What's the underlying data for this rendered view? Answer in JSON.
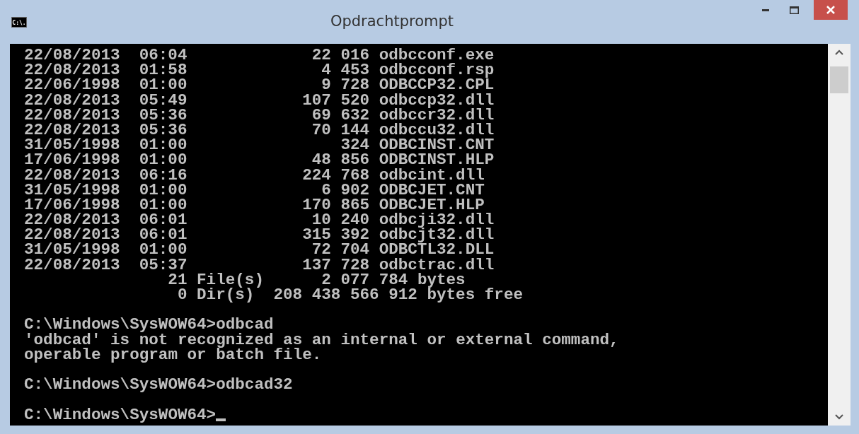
{
  "window": {
    "title": "Opdrachtprompt",
    "icon_text": "C:\\."
  },
  "console": {
    "listing": [
      {
        "date": "22/08/2013",
        "time": "06:04",
        "size": "22 016",
        "name": "odbcconf.exe"
      },
      {
        "date": "22/08/2013",
        "time": "01:58",
        "size": "4 453",
        "name": "odbcconf.rsp"
      },
      {
        "date": "22/06/1998",
        "time": "01:00",
        "size": "9 728",
        "name": "ODBCCP32.CPL"
      },
      {
        "date": "22/08/2013",
        "time": "05:49",
        "size": "107 520",
        "name": "odbccp32.dll"
      },
      {
        "date": "22/08/2013",
        "time": "05:36",
        "size": "69 632",
        "name": "odbccr32.dll"
      },
      {
        "date": "22/08/2013",
        "time": "05:36",
        "size": "70 144",
        "name": "odbccu32.dll"
      },
      {
        "date": "31/05/1998",
        "time": "01:00",
        "size": "324",
        "name": "ODBCINST.CNT"
      },
      {
        "date": "17/06/1998",
        "time": "01:00",
        "size": "48 856",
        "name": "ODBCINST.HLP"
      },
      {
        "date": "22/08/2013",
        "time": "06:16",
        "size": "224 768",
        "name": "odbcint.dll"
      },
      {
        "date": "31/05/1998",
        "time": "01:00",
        "size": "6 902",
        "name": "ODBCJET.CNT"
      },
      {
        "date": "17/06/1998",
        "time": "01:00",
        "size": "170 865",
        "name": "ODBCJET.HLP"
      },
      {
        "date": "22/08/2013",
        "time": "06:01",
        "size": "10 240",
        "name": "odbcji32.dll"
      },
      {
        "date": "22/08/2013",
        "time": "06:01",
        "size": "315 392",
        "name": "odbcjt32.dll"
      },
      {
        "date": "31/05/1998",
        "time": "01:00",
        "size": "72 704",
        "name": "ODBCTL32.DLL"
      },
      {
        "date": "22/08/2013",
        "time": "05:37",
        "size": "137 728",
        "name": "odbctrac.dll"
      }
    ],
    "summary": [
      {
        "count": "21",
        "rest": "File(s)      2 077 784 bytes"
      },
      {
        "count": "0",
        "rest": "Dir(s)  208 438 566 912 bytes free"
      }
    ],
    "blocks": [
      [
        "C:\\Windows\\SysWOW64>odbcad",
        "'odbcad' is not recognized as an internal or external command,",
        "operable program or batch file."
      ],
      [
        "C:\\Windows\\SysWOW64>odbcad32"
      ]
    ],
    "prompt": "C:\\Windows\\SysWOW64>"
  }
}
